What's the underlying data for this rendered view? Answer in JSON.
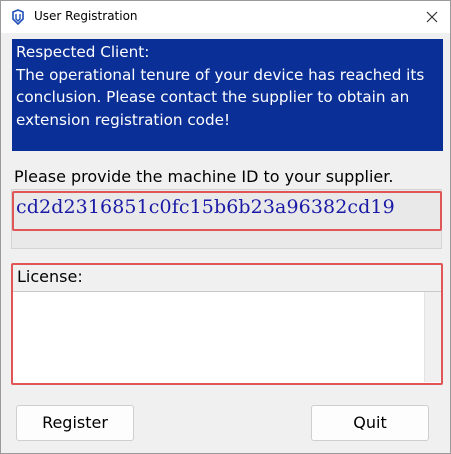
{
  "window": {
    "title": "User Registration",
    "icon": "app-logo-icon",
    "close_icon": "close-icon"
  },
  "notice": {
    "lines": [
      "Respected Client:",
      "The operational tenure of your device has reached its",
      "conclusion. Please contact the supplier to obtain an",
      "extension registration code!"
    ],
    "background": "#0a2f96",
    "text_color": "#ffffff"
  },
  "machine": {
    "prompt": "Please provide the machine ID to your supplier.",
    "id": "cd2d2316851c0fc15b6b23a96382cd19",
    "id_color": "#1a1aa6"
  },
  "license": {
    "label": "License:",
    "value": "",
    "placeholder": ""
  },
  "buttons": {
    "register": "Register",
    "quit": "Quit"
  },
  "colors": {
    "highlight": "#e05656"
  }
}
